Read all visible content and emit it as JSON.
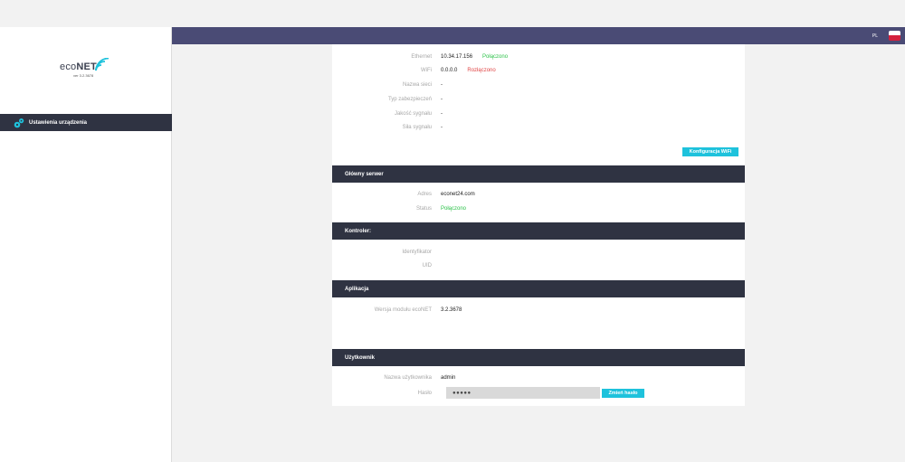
{
  "sidebar": {
    "logo": {
      "prefix": "eco",
      "brand": "NET",
      "version": "ver 3.2.3678"
    },
    "items": [
      {
        "label": "Ustawienia urządzenia",
        "icon": "gears-icon"
      }
    ]
  },
  "topbar": {
    "language": "PL",
    "flag_colors": [
      "#ffffff",
      "#d4213d"
    ]
  },
  "network": {
    "ethernet": {
      "label": "Ethernet",
      "value": "10.34.17.156",
      "status": "Połączono"
    },
    "wifi": {
      "label": "WiFi",
      "value": "0.0.0.0",
      "status": "Rozłączono"
    },
    "network_name": {
      "label": "Nazwa sieci",
      "value": "-"
    },
    "security_type": {
      "label": "Typ zabezpieczeń",
      "value": "-"
    },
    "signal_quality": {
      "label": "Jakość sygnału",
      "value": "-"
    },
    "signal_strength": {
      "label": "Siła sygnału",
      "value": "-"
    },
    "wifi_config_button": "Konfiguracja WiFi"
  },
  "main_server": {
    "title": "Główny serwer",
    "address": {
      "label": "Adres",
      "value": "econet24.com"
    },
    "status": {
      "label": "Status",
      "value": "Połączono"
    }
  },
  "controller": {
    "title": "Kontroler:",
    "identifier": {
      "label": "Identyfikator",
      "value": ""
    },
    "uid": {
      "label": "UID",
      "value": ""
    }
  },
  "application": {
    "title": "Aplikacja",
    "module_version": {
      "label": "Wersja modułu ecoNET",
      "value": "3.2.3678"
    }
  },
  "user": {
    "title": "Użytkownik",
    "username": {
      "label": "Nazwa użytkownika",
      "value": "admin"
    },
    "password": {
      "label": "Hasło",
      "value": "●●●●●"
    },
    "change_password_button": "Zmień hasło"
  },
  "colors": {
    "accent": "#1ec2dc",
    "topbar": "#4a4b75",
    "section_header": "#2f3342",
    "ok": "#2dc24a",
    "error": "#e04545"
  }
}
